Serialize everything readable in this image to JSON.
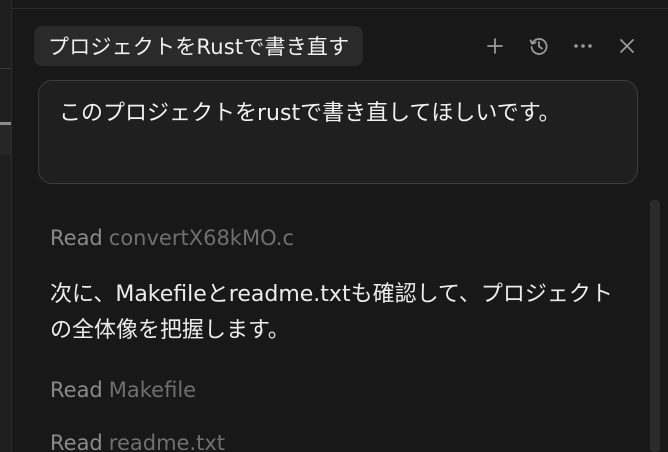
{
  "header": {
    "title": "プロジェクトをRustで書き直す",
    "actions": [
      {
        "name": "new-chat-button",
        "icon": "plus-icon"
      },
      {
        "name": "history-button",
        "icon": "history-icon"
      },
      {
        "name": "more-button",
        "icon": "ellipsis-icon"
      },
      {
        "name": "close-button",
        "icon": "close-icon"
      }
    ]
  },
  "user_message": {
    "text": "このプロジェクトをrustで書き直してほしいです。"
  },
  "transcript": {
    "items": [
      {
        "type": "tool",
        "verb": "Read",
        "file": "convertX68kMO.c"
      },
      {
        "type": "text",
        "text": "次に、Makefileとreadme.txtも確認して、プロジェクトの全体像を把握します。"
      },
      {
        "type": "tool",
        "verb": "Read",
        "file": "Makefile"
      },
      {
        "type": "tool",
        "verb": "Read",
        "file": "readme.txt"
      }
    ]
  },
  "colors": {
    "background": "#181818",
    "chip": "#2a2a2a",
    "muted_text": "#8a8a8a",
    "primary_text": "#ececec"
  }
}
